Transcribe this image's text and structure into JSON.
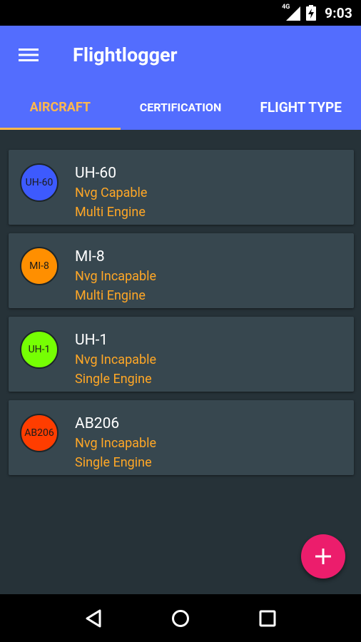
{
  "status_bar": {
    "network": "4G",
    "time": "9:03"
  },
  "app_bar": {
    "title": "Flightlogger"
  },
  "tabs": [
    {
      "label": "AIRCRAFT",
      "active": true
    },
    {
      "label": "CERTIFICATION",
      "active": false
    },
    {
      "label": "FLIGHT TYPE",
      "active": false
    }
  ],
  "aircraft": [
    {
      "badge": "UH-60",
      "name": "UH-60",
      "nvg": "Nvg Capable",
      "engine": "Multi Engine",
      "color": "#3d5afe"
    },
    {
      "badge": "MI-8",
      "name": "MI-8",
      "nvg": "Nvg Incapable",
      "engine": "Multi Engine",
      "color": "#ff8f00"
    },
    {
      "badge": "UH-1",
      "name": "UH-1",
      "nvg": "Nvg Incapable",
      "engine": "Single Engine",
      "color": "#76ff03"
    },
    {
      "badge": "AB206",
      "name": "AB206",
      "nvg": "Nvg Incapable",
      "engine": "Single Engine",
      "color": "#ff3d00"
    }
  ],
  "fab": {
    "icon": "plus-icon"
  },
  "nav_bar": {
    "icons": [
      "back-icon",
      "home-icon",
      "recents-icon"
    ]
  },
  "colors": {
    "primary": "#536dfe",
    "accent": "#ffb74d",
    "fab": "#ec1d6c",
    "background": "#263238",
    "card": "#37474f"
  }
}
